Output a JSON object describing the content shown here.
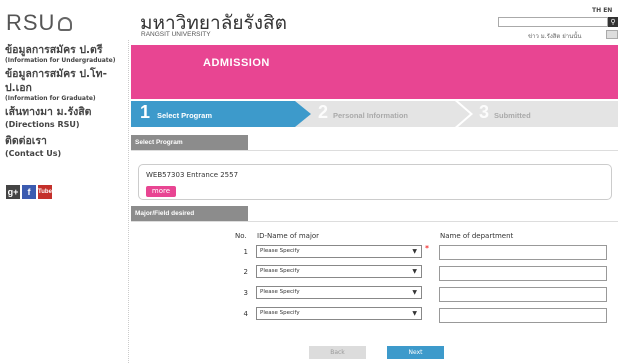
{
  "header": {
    "logo": "RSU",
    "uni_name": "มหาวิทยาลัยรังสิต",
    "uni_sub": "RANGSIT UNIVERSITY",
    "lang": "TH EN",
    "search_placeholder": "",
    "search_icon": "search-icon",
    "news_text": "ข่าว ม.รังสิต ย่านนั้น"
  },
  "leftnav": [
    {
      "th": "ข้อมูลการสมัคร ป.ตรี",
      "en": "(Information for Undergraduate)"
    },
    {
      "th": "ข้อมูลการสมัคร ป.โท-ป.เอก",
      "en": "(Information for Graduate)"
    },
    {
      "th": "เส้นทางมา ม.รังสิต",
      "en": "(Directions RSU)"
    },
    {
      "th": "ติดต่อเรา",
      "en": "(Contact Us)"
    }
  ],
  "social": {
    "gplus": "g+",
    "fb": "f",
    "yt": "Tube"
  },
  "banner": {
    "title": "ADMISSION",
    "color": "#e84592"
  },
  "steps": [
    {
      "num": "1",
      "label": "Select Program",
      "active": true
    },
    {
      "num": "2",
      "label": "Personal Information",
      "active": false
    },
    {
      "num": "3",
      "label": "Submitted",
      "active": false
    }
  ],
  "sections": {
    "select_program": "Select Program",
    "major": "Major/Field desired"
  },
  "program": {
    "name": "WEB57303 Entrance 2557",
    "more_label": "more"
  },
  "table": {
    "headers": {
      "no": "No.",
      "major": "ID-Name of major",
      "dept": "Name of department"
    },
    "rows": [
      {
        "no": "1",
        "select": "Please Specify",
        "required": "*"
      },
      {
        "no": "2",
        "select": "Please Specify",
        "required": ""
      },
      {
        "no": "3",
        "select": "Please Specify",
        "required": ""
      },
      {
        "no": "4",
        "select": "Please Specify",
        "required": ""
      }
    ]
  },
  "buttons": {
    "back": "Back",
    "next": "Next"
  },
  "colors": {
    "accent": "#3d9acb",
    "pink": "#e84592"
  }
}
